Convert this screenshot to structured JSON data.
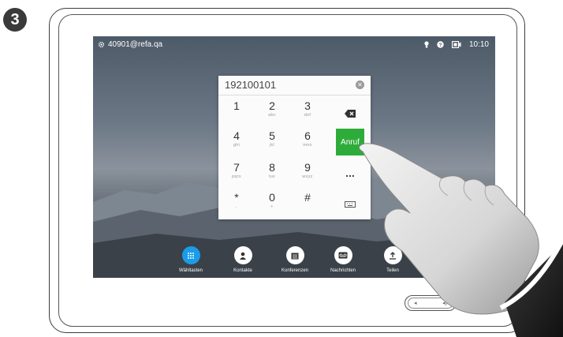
{
  "step_number": "3",
  "status_bar": {
    "address": "40901@refa.qa",
    "time": "10:10"
  },
  "dial": {
    "entered_number": "192100101",
    "keys": [
      {
        "digit": "1",
        "letters": ""
      },
      {
        "digit": "2",
        "letters": "abc"
      },
      {
        "digit": "3",
        "letters": "def"
      },
      {
        "digit": "4",
        "letters": "ghi"
      },
      {
        "digit": "5",
        "letters": "jkl"
      },
      {
        "digit": "6",
        "letters": "mno"
      },
      {
        "digit": "7",
        "letters": "pqrs"
      },
      {
        "digit": "8",
        "letters": "tuv"
      },
      {
        "digit": "9",
        "letters": "wxyz"
      },
      {
        "digit": "*",
        "letters": "."
      },
      {
        "digit": "0",
        "letters": "+"
      },
      {
        "digit": "#",
        "letters": ""
      }
    ],
    "call_label": "Anruf",
    "more_label": "..."
  },
  "nav": [
    {
      "label": "Wähltasten",
      "icon": "keypad-icon",
      "active": true
    },
    {
      "label": "Kontakte",
      "icon": "person-icon",
      "active": false
    },
    {
      "label": "Konferenzen",
      "icon": "calendar-icon",
      "active": false
    },
    {
      "label": "Nachrichten",
      "icon": "voicemail-icon",
      "active": false
    },
    {
      "label": "Teilen",
      "icon": "share-icon",
      "active": false
    }
  ],
  "colors": {
    "call_button": "#2eac3a",
    "active_nav": "#1a9ce8"
  }
}
